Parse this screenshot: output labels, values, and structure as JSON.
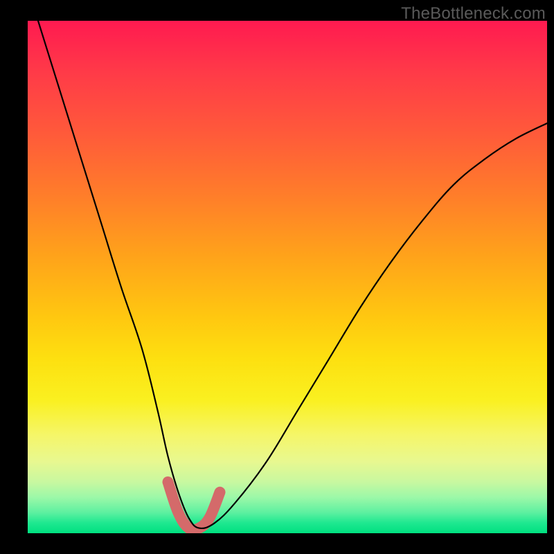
{
  "watermark": "TheBottleneck.com",
  "chart_data": {
    "type": "line",
    "title": "",
    "xlabel": "",
    "ylabel": "",
    "xlim": [
      0,
      100
    ],
    "ylim": [
      0,
      100
    ],
    "series": [
      {
        "name": "bottleneck-curve",
        "x": [
          2,
          6,
          10,
          14,
          18,
          22,
          25,
          27,
          29,
          31,
          33,
          36,
          40,
          46,
          52,
          58,
          64,
          70,
          76,
          82,
          88,
          94,
          100
        ],
        "values": [
          100,
          87,
          74,
          61,
          48,
          36,
          24,
          15,
          8,
          3,
          1,
          2,
          6,
          14,
          24,
          34,
          44,
          53,
          61,
          68,
          73,
          77,
          80
        ]
      },
      {
        "name": "ideal-zone",
        "x": [
          27,
          29,
          31,
          33,
          35,
          37
        ],
        "values": [
          10,
          4,
          1,
          1,
          3,
          8
        ]
      }
    ],
    "gradient": {
      "top": "#ff1a50",
      "mid": "#fde010",
      "bottom": "#00e080"
    }
  }
}
